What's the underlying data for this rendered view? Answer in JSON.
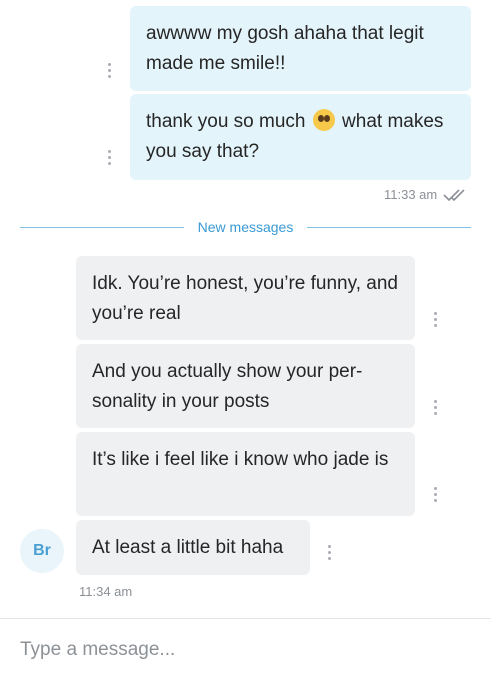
{
  "messages": [
    {
      "text": "awwww my gosh ahaha that legit made me smile!!"
    },
    {
      "text_before": "thank you so much",
      "emoji": "pleading-face",
      "text_after": "what makes you say that?"
    },
    {
      "text": "Idk. You’re honest, you’re funny, and you’re real"
    },
    {
      "text": "And you actually show your per-sonality in your posts"
    },
    {
      "text": "It’s like i feel like i know who jade is"
    },
    {
      "text": "At least a little bit haha"
    }
  ],
  "times": {
    "sent": "11:33 am",
    "received": "11:34 am"
  },
  "divider": {
    "label": "New messages"
  },
  "avatar": {
    "initials": "Br"
  },
  "composer": {
    "placeholder": "Type a message..."
  },
  "colors": {
    "outgoing_bubble": "#e4f4fb",
    "incoming_bubble": "#eff0f2",
    "accent": "#3a9ad3"
  }
}
